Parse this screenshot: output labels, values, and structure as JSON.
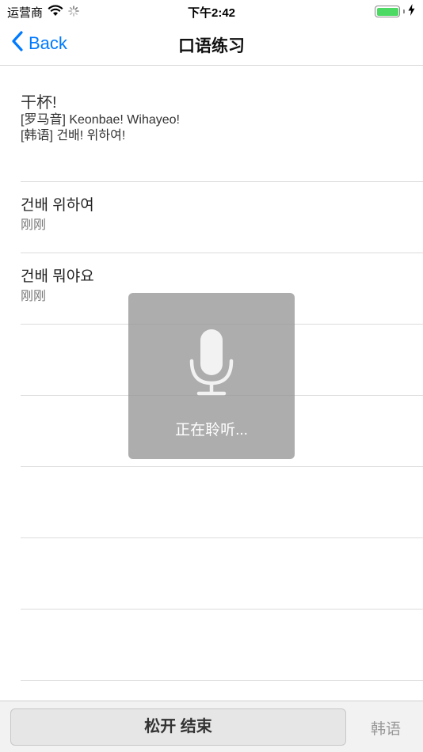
{
  "status_bar": {
    "carrier": "运营商",
    "time": "下午2:42",
    "battery_level": 1.0,
    "icons": [
      "wifi-icon",
      "activity-spinner-icon",
      "battery-icon",
      "charging-bolt-icon"
    ]
  },
  "nav": {
    "back_label": "Back",
    "title": "口语练习"
  },
  "featured": {
    "title": "干杯!",
    "romanization": "[罗马音] Keonbae! Wihayeo!",
    "korean": "[韩语] 건배! 위하여!"
  },
  "history": [
    {
      "text": "건배 위하여",
      "time": "刚刚"
    },
    {
      "text": "건배 뭐야요",
      "time": "刚刚"
    }
  ],
  "hud": {
    "label": "正在聆听...",
    "icon": "microphone-icon"
  },
  "toolbar": {
    "hold_label": "松开 结束",
    "language_label": "韩语"
  },
  "colors": {
    "accent": "#007aff",
    "battery": "#4cd964",
    "hud_bg": "#969696"
  }
}
